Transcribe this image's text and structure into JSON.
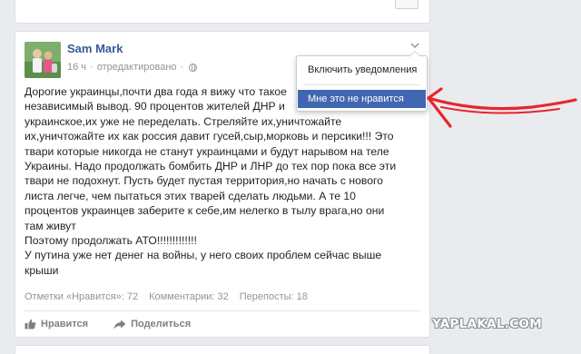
{
  "post": {
    "author": "Sam Mark",
    "meta_time": "16 ч",
    "meta_sep": "·",
    "meta_edited": "отредактировано",
    "meta_sep2": "·",
    "text": "Дорогие украинцы,почти два года я вижу что такое\nнезависимый вывод. 90 процентов жителей ДНР и\nукраинское,их уже не переделать. Стреляйте их,уничтожайте\nих,уничтожайте их как россия давит гусей,сыр,морковь и персики!!! Это\nтвари которые никогда не станут украинцами и будут нарывом на теле\nУкраины. Надо продолжать бомбить ДНР и ЛНР до тех пор пока все эти\nтвари не подохнут. Пусть будет пустая территория,но начать с нового\nлиста легче, чем пытаться этих тварей сделать людьми. А те 10\nпроцентов украинцев заберите к себе,им нелегко в тылу врага,но они\nтам живут\nПоэтому продолжать АТО!!!!!!!!!!!!!\nУ путина уже нет денег на войны, у него своих проблем сейчас выше\nкрыши",
    "stats": {
      "likes": "Отметки «Нравится»: 72",
      "comments": "Комментарии: 32",
      "shares": "Перепосты: 18"
    },
    "actions": {
      "like": "Нравится",
      "share": "Поделиться"
    }
  },
  "menu": {
    "items": [
      {
        "label": "Включить уведомления"
      },
      {
        "label": "Мне это не нравится"
      }
    ]
  },
  "watermark": "YAPLAKAL.COM",
  "colors": {
    "link": "#365899",
    "highlight": "#4267b2",
    "annotation": "#e8242c"
  }
}
